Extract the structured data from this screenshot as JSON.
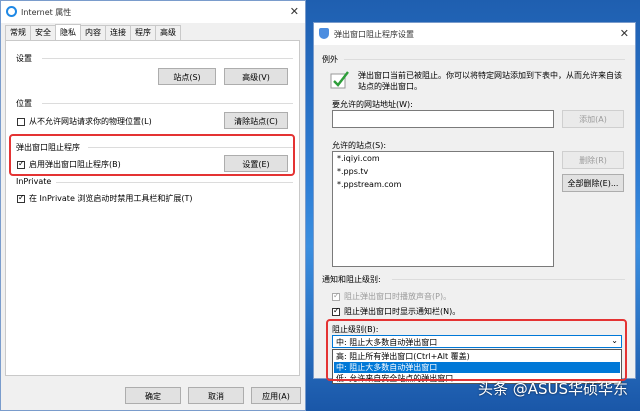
{
  "left_window": {
    "title": "Internet 属性",
    "tabs": [
      "常规",
      "安全",
      "隐私",
      "内容",
      "连接",
      "程序",
      "高级"
    ],
    "active_tab": "隐私",
    "settings_label": "设置",
    "sites_button": "站点(S)",
    "advanced_button": "高级(V)",
    "location_label": "位置",
    "location_checkbox": "从不允许网站请求你的物理位置(L)",
    "clear_sites_button": "清除站点(C)",
    "popup_group_label": "弹出窗口阻止程序",
    "popup_checkbox": "启用弹出窗口阻止程序(B)",
    "popup_settings_button": "设置(E)",
    "inprivate_label": "InPrivate",
    "inprivate_checkbox": "在 InPrivate 浏览启动时禁用工具栏和扩展(T)",
    "ok_button": "确定",
    "cancel_button": "取消",
    "apply_button": "应用(A)"
  },
  "right_window": {
    "title": "弹出窗口阻止程序设置",
    "exceptions_label": "例外",
    "info_line1": "弹出窗口当前已被阻止。你可以将特定网站添加到下表中，从而允许来自该",
    "info_line2": "站点的弹出窗口。",
    "allow_address_label": "要允许的网站地址(W):",
    "address_value": "",
    "add_button": "添加(A)",
    "allowed_sites_label": "允许的站点(S):",
    "allowed_sites": [
      "*.iqiyi.com",
      "*.pps.tv",
      "*.ppstream.com"
    ],
    "remove_button": "删除(R)",
    "remove_all_button": "全部删除(E)...",
    "notify_label": "通知和阻止级别:",
    "sound_checkbox": "阻止弹出窗口时播放声音(P)。",
    "infobar_checkbox": "阻止弹出窗口时显示通知栏(N)。",
    "blocking_level_label": "阻止级别(B):",
    "blocking_level_selected": "中: 阻止大多数自动弹出窗口",
    "blocking_options": [
      "高: 阻止所有弹出窗口(Ctrl+Alt 覆盖)",
      "中: 阻止大多数自动弹出窗口",
      "低: 允许来自安全站点的弹出窗口"
    ]
  },
  "watermark": "头条 @ASUS华硕华东",
  "colors": {
    "highlight_red": "#e43333",
    "selection_blue": "#0078d7"
  }
}
